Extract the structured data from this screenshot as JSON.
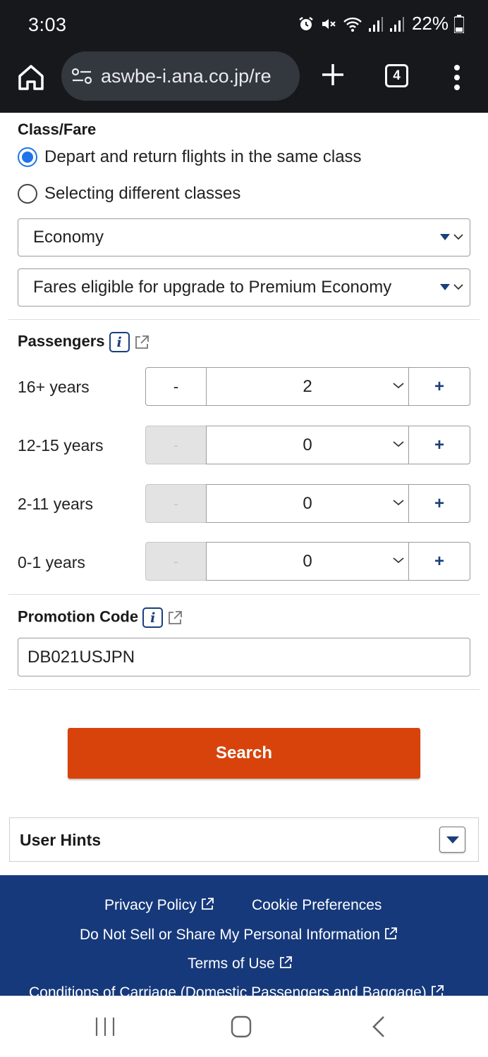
{
  "status_bar": {
    "time": "3:03",
    "battery": "22%",
    "icons": [
      "alarm-icon",
      "mute-icon",
      "wifi-icon",
      "signal-icon",
      "signal-icon",
      "battery-icon"
    ]
  },
  "browser": {
    "url": "aswbe-i.ana.co.jp/re",
    "tab_count": "4"
  },
  "class_fare": {
    "title": "Class/Fare",
    "options": [
      {
        "label": "Depart and return flights in the same class",
        "selected": true
      },
      {
        "label": "Selecting different classes",
        "selected": false
      }
    ],
    "cabin_select": "Economy",
    "fare_select": "Fares eligible for upgrade to Premium Economy"
  },
  "passengers": {
    "title": "Passengers",
    "minus_label": "-",
    "plus_label": "+",
    "rows": [
      {
        "label": "16+ years",
        "value": "2",
        "minus_disabled": false
      },
      {
        "label": "12-15 years",
        "value": "0",
        "minus_disabled": true
      },
      {
        "label": "2-11 years",
        "value": "0",
        "minus_disabled": true
      },
      {
        "label": "0-1 years",
        "value": "0",
        "minus_disabled": true
      }
    ]
  },
  "promotion": {
    "title": "Promotion Code",
    "value": "DB021USJPN"
  },
  "search_button": "Search",
  "user_hints": "User Hints",
  "footer": {
    "links": [
      "Privacy Policy",
      "Cookie Preferences",
      "Do Not Sell or Share My Personal Information",
      "Terms of Use",
      "Conditions of Carriage (Domestic Passengers and Baggage)"
    ]
  },
  "colors": {
    "accent_blue": "#1f74e8",
    "ana_navy": "#16397b",
    "search_orange": "#d8430c",
    "disabled_gray": "#e3e3e3"
  }
}
